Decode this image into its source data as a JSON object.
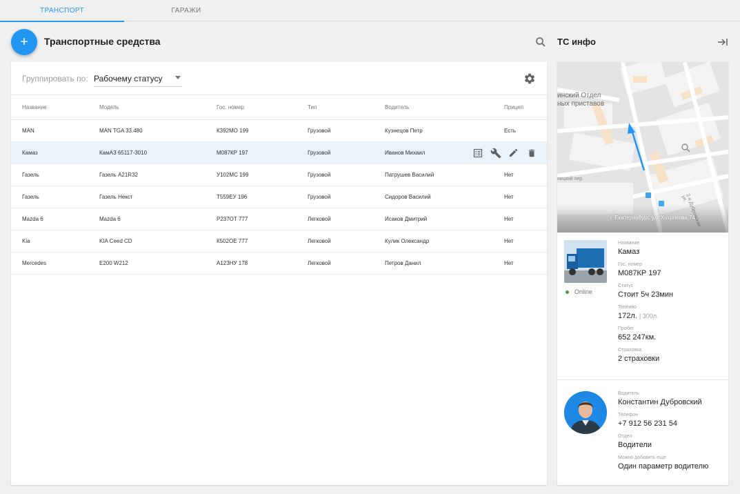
{
  "tabs": [
    {
      "label": "ТРАНСПОРТ",
      "active": true
    },
    {
      "label": "ГАРАЖИ",
      "active": false
    }
  ],
  "left": {
    "add_icon": "plus-icon",
    "title": "Транспортные средства",
    "search_icon": "search-icon"
  },
  "group_by": {
    "label": "Группировать по:",
    "value": "Рабочему статусу",
    "settings_icon": "gear-icon"
  },
  "table": {
    "columns": [
      "Название",
      "Модель",
      "Гос. номер",
      "Тип",
      "Водитель",
      "Прицеп"
    ],
    "rows": [
      [
        "MAN",
        "MAN TGA 33.480",
        "К392МО 199",
        "Грузовой",
        "Кузнецов Петр",
        "Есть"
      ],
      [
        "Камаз",
        "КамАЗ 65117-3010",
        "М087КР 197",
        "Грузовой",
        "Иванов Михаил",
        ""
      ],
      [
        "Газель",
        "Газель A21R32",
        "У102МС 199",
        "Грузовой",
        "Патрушев Василий",
        "Нет"
      ],
      [
        "Газель",
        "Газель Некст",
        "Т559ЕУ 196",
        "Грузовой",
        "Сидоров Василий",
        "Нет"
      ],
      [
        "Mazda 6",
        "Mazda 6",
        "Р237ОТ 777",
        "Легковой",
        "Исаков Дмитрий",
        "Нет"
      ],
      [
        "Kia",
        "KIA Ceed CD",
        "К502ОЕ 777",
        "Легковой",
        "Кулик Олександр",
        "Нет"
      ],
      [
        "Mercedes",
        "E200 W212",
        "А123НУ 178",
        "Легковой",
        "Петров Данил",
        "Нет"
      ]
    ],
    "selected_row": 1,
    "row_action_icons": [
      "list-icon",
      "wrench-icon",
      "pencil-icon",
      "trash-icon"
    ]
  },
  "info": {
    "title": "ТС инфо",
    "collapse_icon": "collapse-right-icon",
    "map": {
      "labels": [
        "инский Отдел",
        "ных приставов"
      ],
      "streets": [
        "пицкий пер.",
        "2-я Дубровская ул."
      ],
      "address": "г. Екатеринбург, ул. Хохрякова 74"
    },
    "status_text": "Online",
    "vehicle": [
      {
        "label": "Название",
        "value": "Камаз"
      },
      {
        "label": "Гос. номер",
        "value": "М087КР 197"
      },
      {
        "label": "Статус",
        "value": "Стоит 5ч 23мин"
      },
      {
        "label": "Топливо",
        "value": "172л.",
        "sub": "| 300л."
      },
      {
        "label": "Пробег",
        "value": "652 247км."
      },
      {
        "label": "Страховка",
        "value": "2 страховки"
      }
    ],
    "driver": [
      {
        "label": "Водитель",
        "value": "Константин Дубровский"
      },
      {
        "label": "Телефон",
        "value": "+7 912 56 231 54"
      },
      {
        "label": "Отдел",
        "value": "Водители"
      },
      {
        "label": "Можно добавить еще",
        "value": "Один параметр водителю"
      }
    ]
  },
  "colors": {
    "accent": "#2196f3",
    "selected_row": "#e8f3fc",
    "online": "#43a047"
  }
}
